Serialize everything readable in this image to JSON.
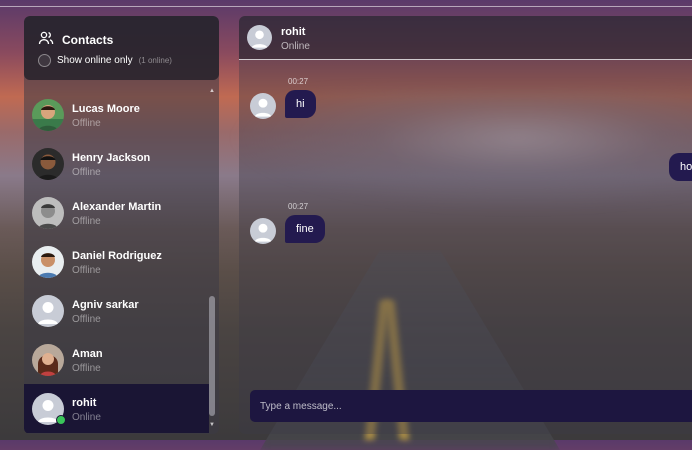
{
  "sidebar": {
    "title": "Contacts",
    "show_online_label": "Show online only",
    "online_count": "(1 online)",
    "contacts": [
      {
        "name": "Lucas Moore",
        "status": "Offline",
        "avatar": "photo"
      },
      {
        "name": "Henry Jackson",
        "status": "Offline",
        "avatar": "photo"
      },
      {
        "name": "Alexander Martin",
        "status": "Offline",
        "avatar": "photo"
      },
      {
        "name": "Daniel Rodriguez",
        "status": "Offline",
        "avatar": "photo"
      },
      {
        "name": "Agniv sarkar",
        "status": "Offline",
        "avatar": "default"
      },
      {
        "name": "Aman",
        "status": "Offline",
        "avatar": "photo"
      },
      {
        "name": "rohit",
        "status": "Online",
        "avatar": "default",
        "active": true
      }
    ]
  },
  "chat": {
    "name": "rohit",
    "status": "Online",
    "messages": [
      {
        "time": "00:27",
        "text": "hi",
        "direction": "incoming"
      },
      {
        "time": "",
        "text": "ho",
        "direction": "outgoing"
      },
      {
        "time": "00:27",
        "text": "fine",
        "direction": "incoming"
      }
    ],
    "composer_placeholder": "Type a message..."
  },
  "colors": {
    "bubble": "#231a4f",
    "active_contact": "#1a1534",
    "online_dot": "#3ac45a"
  },
  "icons": [
    "users-icon",
    "default-avatar-icon",
    "scroll-up-icon",
    "scroll-down-icon"
  ]
}
